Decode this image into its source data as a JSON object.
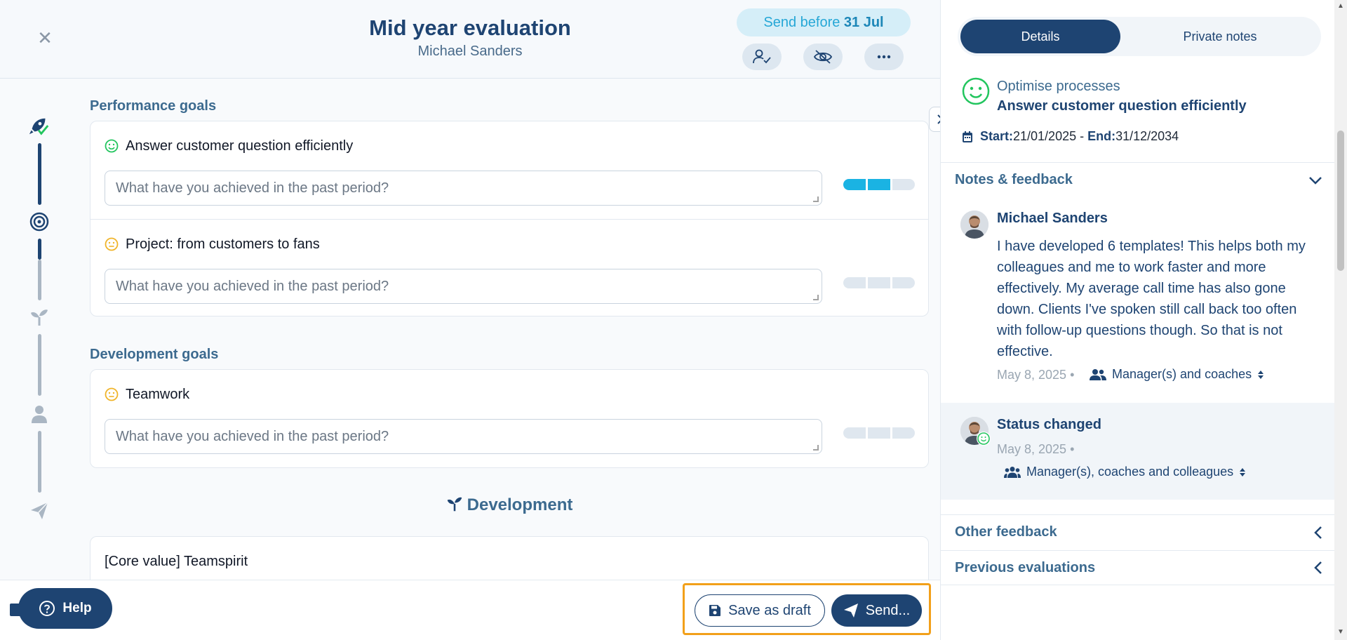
{
  "header": {
    "title": "Mid year evaluation",
    "subtitle": "Michael Sanders",
    "send_before_prefix": "Send before ",
    "send_before_date": "31 Jul"
  },
  "performance": {
    "label": "Performance goals",
    "goals": [
      {
        "title": "Answer customer question efficiently",
        "placeholder": "What have you achieved in the past period?",
        "progress": 2,
        "mood": "happy"
      },
      {
        "title": "Project: from customers to fans",
        "placeholder": "What have you achieved in the past period?",
        "progress": 0,
        "mood": "neutral"
      }
    ]
  },
  "development_goals": {
    "label": "Development goals",
    "goals": [
      {
        "title": "Teamwork",
        "placeholder": "What have you achieved in the past period?",
        "progress": 0,
        "mood": "neutral"
      }
    ]
  },
  "development_section": {
    "heading": "Development",
    "first_item": "[Core value] Teamspirit"
  },
  "footer": {
    "help": "Help",
    "save_draft": "Save as draft",
    "send": "Send..."
  },
  "sidebar": {
    "tabs": [
      "Details",
      "Private notes"
    ],
    "goal_category": "Optimise processes",
    "goal_name": "Answer customer question efficiently",
    "start_label": "Start:",
    "start_date": "21/01/2025",
    "separator": " - ",
    "end_label": "End:",
    "end_date": "31/12/2034",
    "notes_header": "Notes & feedback",
    "feedback": [
      {
        "author": "Michael Sanders",
        "text": "I have developed 6 templates! This helps both my colleagues and me to work faster and more effectively. My average call time has also gone down. Clients I've spoken still call back too often with follow-up questions though. So that is not effective.",
        "date": "May 8, 2025 •",
        "visibility": "Manager(s) and coaches"
      },
      {
        "author": "Status changed",
        "date": "May 8, 2025 •",
        "visibility": "Manager(s), coaches and colleagues"
      }
    ],
    "other_feedback": "Other feedback",
    "previous_evaluations": "Previous evaluations"
  },
  "colors": {
    "primary": "#1e4472",
    "accent": "#1ab3e3",
    "highlight": "#f2a01a"
  }
}
